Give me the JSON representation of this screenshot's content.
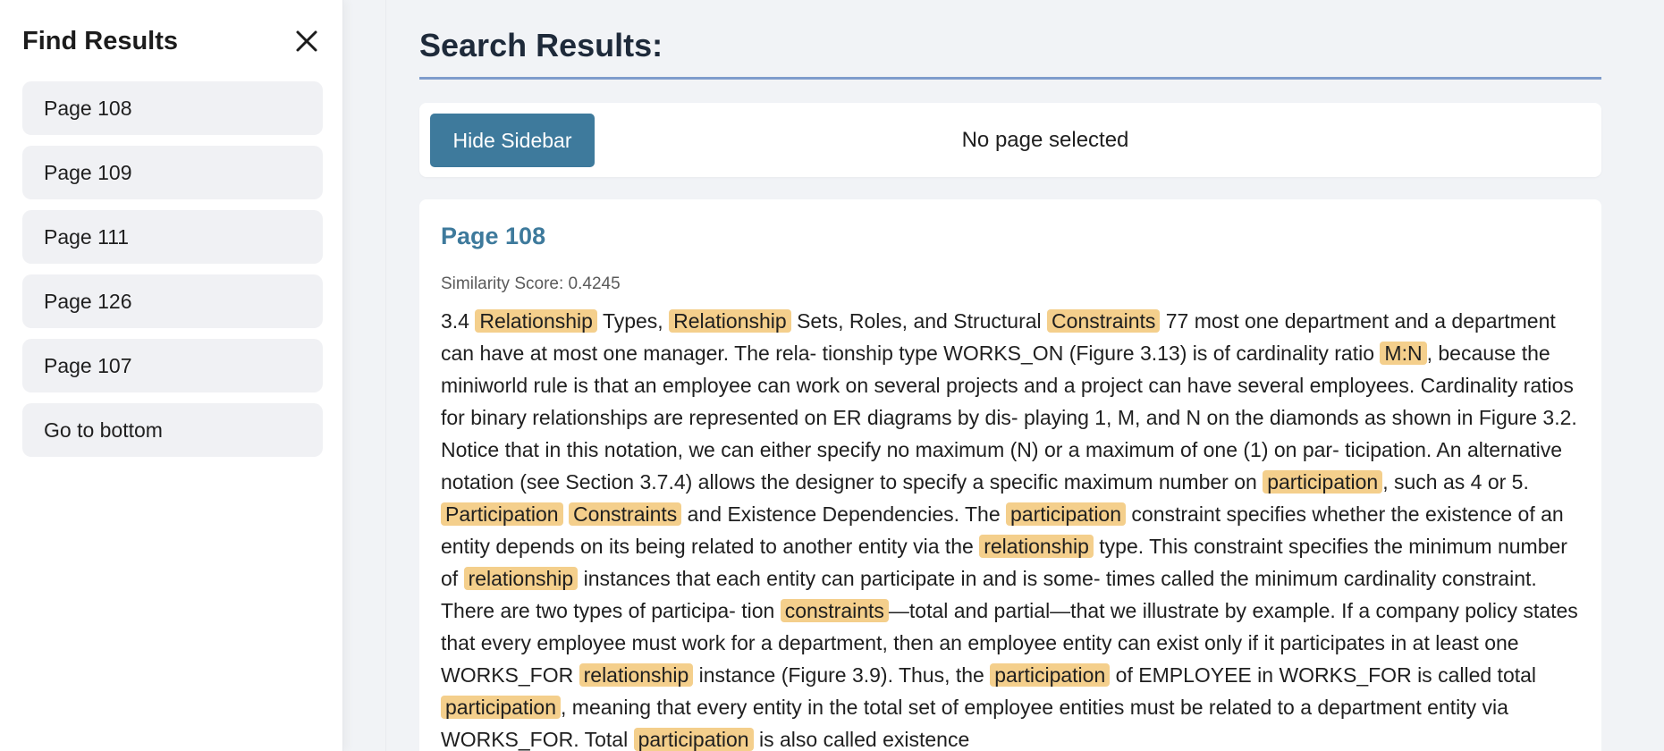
{
  "sidebar": {
    "title": "Find Results",
    "close_icon": "close-icon",
    "items": [
      {
        "label": "Page 108"
      },
      {
        "label": "Page 109"
      },
      {
        "label": "Page 111"
      },
      {
        "label": "Page 126"
      },
      {
        "label": "Page 107"
      },
      {
        "label": "Go to bottom"
      }
    ]
  },
  "main": {
    "title": "Search Results:",
    "toolbar": {
      "hide_sidebar_label": "Hide Sidebar",
      "page_status": "No page selected"
    },
    "result": {
      "page_label": "Page 108",
      "score_text": "Similarity Score: 0.4245",
      "segments": [
        {
          "t": "3.4 "
        },
        {
          "t": "Relationship",
          "hl": true
        },
        {
          "t": " Types, "
        },
        {
          "t": "Relationship",
          "hl": true
        },
        {
          "t": " Sets, Roles, and Structural "
        },
        {
          "t": "Constraints",
          "hl": true
        },
        {
          "t": " 77 most one department and a department can have at most one manager. The rela- tionship type WORKS_ON (Figure 3.13) is of cardinality ratio "
        },
        {
          "t": "M:N",
          "hl": true
        },
        {
          "t": ", because the miniworld rule is that an employee can work on several projects and a project can have several employees. Cardinality ratios for binary relationships are represented on ER diagrams by dis- playing 1, M, and N on the diamonds as shown in Figure 3.2. Notice that in this notation, we can either specify no maximum (N) or a maximum of one (1) on par- ticipation. An alternative notation (see Section 3.7.4) allows the designer to specify a specific maximum number on "
        },
        {
          "t": "participation",
          "hl": true
        },
        {
          "t": ", such as 4 or 5. "
        },
        {
          "t": "Participation",
          "hl": true
        },
        {
          "t": " "
        },
        {
          "t": "Constraints",
          "hl": true
        },
        {
          "t": " and Existence Dependencies. The "
        },
        {
          "t": "participation",
          "hl": true
        },
        {
          "t": " constraint specifies whether the existence of an entity depends on its being related to another entity via the "
        },
        {
          "t": "relationship",
          "hl": true
        },
        {
          "t": " type. This constraint specifies the minimum number of "
        },
        {
          "t": "relationship",
          "hl": true
        },
        {
          "t": " instances that each entity can participate in and is some- times called the minimum cardinality constraint. There are two types of participa- tion "
        },
        {
          "t": "constraints",
          "hl": true
        },
        {
          "t": "—total and partial—that we illustrate by example. If a company policy states that every employee must work for a department, then an employee entity can exist only if it participates in at least one WORKS_FOR "
        },
        {
          "t": "relationship",
          "hl": true
        },
        {
          "t": " instance (Figure 3.9). Thus, the "
        },
        {
          "t": "participation",
          "hl": true
        },
        {
          "t": " of EMPLOYEE in WORKS_FOR is called total "
        },
        {
          "t": "participation",
          "hl": true
        },
        {
          "t": ", meaning that every entity in the total set of employee entities must be related to a department entity via WORKS_FOR. Total "
        },
        {
          "t": "participation",
          "hl": true
        },
        {
          "t": " is also called existence"
        }
      ]
    }
  },
  "colors": {
    "accent": "#3e7a9c",
    "highlight": "#f4cf8c",
    "title_rule": "#7f9ccc"
  }
}
